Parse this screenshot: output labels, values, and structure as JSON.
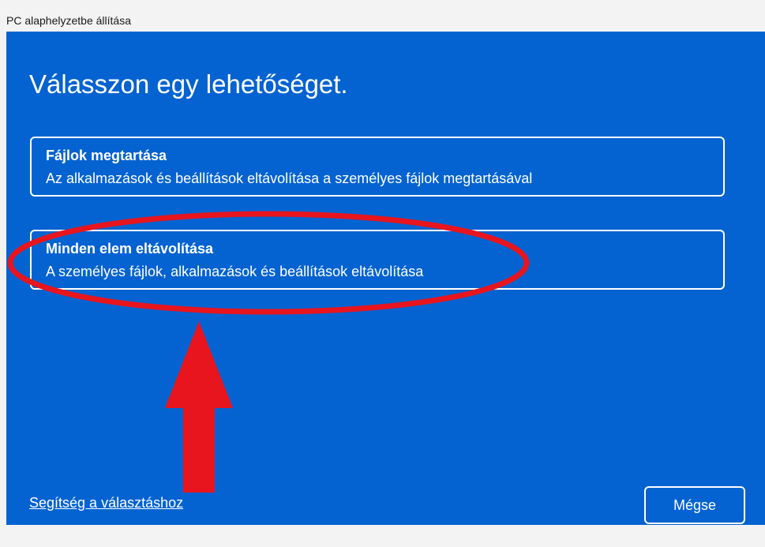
{
  "window": {
    "title": "PC alaphelyzetbe állítása"
  },
  "main": {
    "heading": "Válasszon egy lehetőséget.",
    "options": [
      {
        "title": "Fájlok megtartása",
        "description": "Az alkalmazások és beállítások eltávolítása a személyes fájlok megtartásával"
      },
      {
        "title": "Minden elem eltávolítása",
        "description": "A személyes fájlok, alkalmazások és beállítások eltávolítása"
      }
    ]
  },
  "footer": {
    "help_link": "Segítség a választáshoz",
    "cancel_label": "Mégse"
  },
  "colors": {
    "background_blue": "#0563d1",
    "annotation_red": "#e8151e",
    "titlebar": "#f3f3f3"
  },
  "annotations": {
    "highlight": "red-ellipse-around-remove-everything",
    "pointer": "red-arrow-up"
  }
}
